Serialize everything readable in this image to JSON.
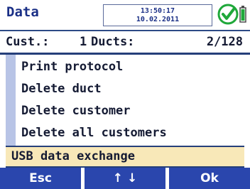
{
  "header": {
    "title": "Data",
    "time": "13:50:17",
    "date": "10.02.2011",
    "status_icon": "check-circle-icon",
    "battery_icon": "battery-icon"
  },
  "info": {
    "cust_label": "Cust.:",
    "cust_value": "1",
    "ducts_label": "Ducts:",
    "ducts_value": "2/128"
  },
  "menu": {
    "items": [
      {
        "label": "Print protocol"
      },
      {
        "label": "Delete duct"
      },
      {
        "label": "Delete customer"
      },
      {
        "label": "Delete all customers"
      },
      {
        "label": "USB data exchange",
        "selected": true
      }
    ]
  },
  "softkeys": {
    "left": "Esc",
    "middle": "↑ ↓",
    "right": "Ok"
  },
  "colors": {
    "accent_blue": "#2a46ad",
    "title_blue": "#1a2f86",
    "selection_fill": "#f8e8b8",
    "status_green": "#1fa83a"
  }
}
